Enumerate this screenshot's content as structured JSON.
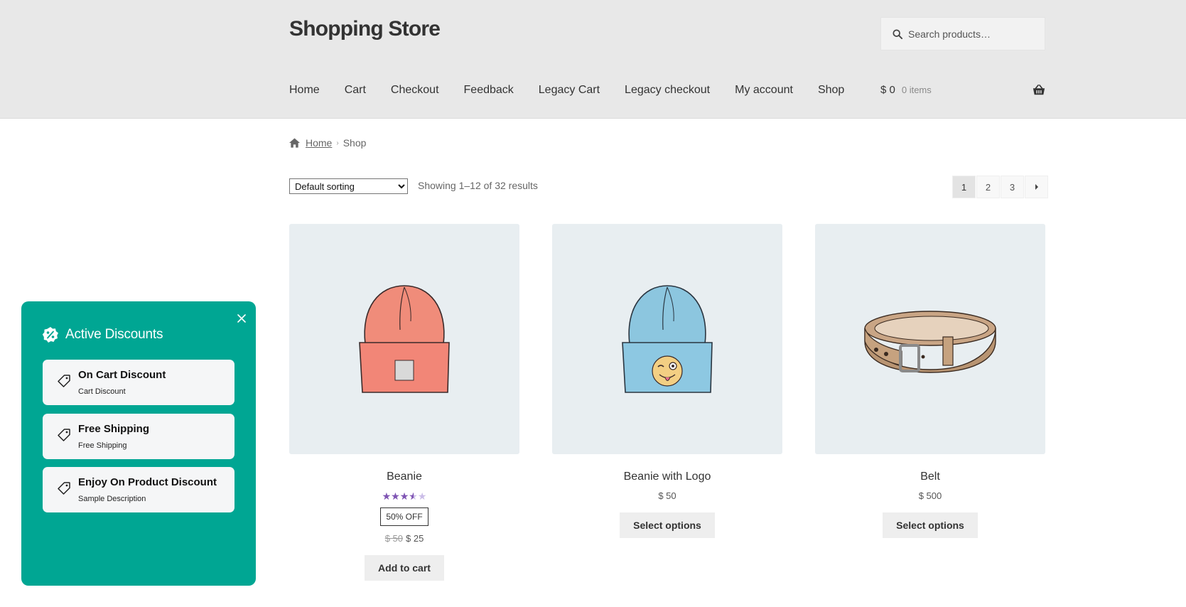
{
  "header": {
    "site_title": "Shopping Store",
    "search_placeholder": "Search products…",
    "nav": [
      "Home",
      "Cart",
      "Checkout",
      "Feedback",
      "Legacy Cart",
      "Legacy checkout",
      "My account",
      "Shop"
    ],
    "mini_cart": {
      "amount": "$ 0",
      "count": "0 items"
    }
  },
  "breadcrumb": {
    "home": "Home",
    "current": "Shop"
  },
  "toolbar": {
    "sort_selected": "Default sorting",
    "result_count": "Showing 1–12 of 32 results",
    "pages": [
      "1",
      "2",
      "3"
    ],
    "current_page": "1"
  },
  "products": [
    {
      "name": "Beanie",
      "rating": 3.5,
      "rating_max": 5,
      "badge": "50% OFF",
      "regular_price": "$ 50",
      "sale_price": "$ 25",
      "button": "Add to cart",
      "image_icon": "orange-beanie-image"
    },
    {
      "name": "Beanie with Logo",
      "price": "$ 50",
      "button": "Select options",
      "image_icon": "blue-beanie-logo-image"
    },
    {
      "name": "Belt",
      "price": "$ 500",
      "button": "Select options",
      "image_icon": "belt-image"
    }
  ],
  "discounts_panel": {
    "title": "Active Discounts",
    "accent_color": "#00a693",
    "items": [
      {
        "name": "On Cart Discount",
        "description": "Cart Discount"
      },
      {
        "name": "Free Shipping",
        "description": "Free Shipping"
      },
      {
        "name": "Enjoy On Product Discount",
        "description": "Sample Description"
      }
    ]
  },
  "colors": {
    "header_bg": "#e8e8e8",
    "product_bg": "#e8eef1",
    "star_fill": "#7f54b3"
  }
}
